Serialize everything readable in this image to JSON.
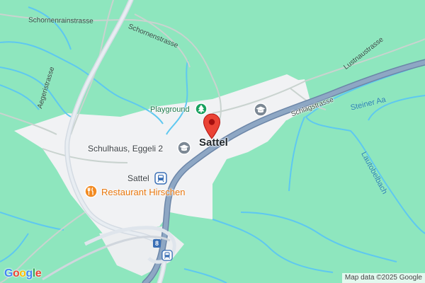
{
  "streets": {
    "schornenrainstrasse": "Schornenrainstrasse",
    "schornenstrasse": "Schornenstrasse",
    "aegeristrasse": "Aegeristrasse",
    "schlagstrasse": "Schlagstrasse",
    "lustnaustrasse": "Lustnaustrasse"
  },
  "waterways": {
    "steiner_aa": "Steiner Aa",
    "lautobelbach": "Lautobelbach"
  },
  "places": {
    "town": "Sattel",
    "playground": "Playground",
    "school": "Schulhaus, Eggeli 2",
    "station": "Sattel",
    "restaurant": "Restaurant Hirschen"
  },
  "road_shield": "8",
  "icons": {
    "pin": "location-pin-icon",
    "playground": "tree-icon",
    "school": "graduation-cap-icon",
    "station": "train-icon",
    "restaurant": "fork-knife-icon"
  },
  "brand": "Google",
  "attribution": "Map data ©2025 Google",
  "colors": {
    "background": "#8ee6be",
    "built_area": "#f1f2f4",
    "highway": "#8aa1bf",
    "river": "#5ec8f0",
    "pin": "#ea4335",
    "food": "#f28b22",
    "park_icon": "#19a15f",
    "station_icon": "#3a6fb5"
  }
}
